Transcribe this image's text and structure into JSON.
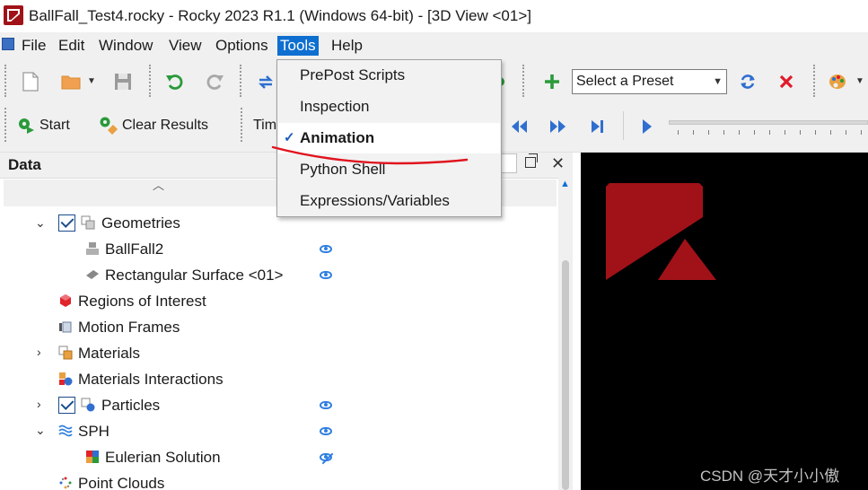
{
  "window": {
    "title": "BallFall_Test4.rocky - Rocky 2023 R1.1 (Windows 64-bit) - [3D View <01>]",
    "icon": "rocky-app-icon"
  },
  "menu": {
    "items": [
      {
        "label": "File",
        "name": "menu-file"
      },
      {
        "label": "Edit",
        "name": "menu-edit"
      },
      {
        "label": "Window",
        "name": "menu-window"
      },
      {
        "label": "View",
        "name": "menu-view"
      },
      {
        "label": "Options",
        "name": "menu-options"
      },
      {
        "label": "Tools",
        "name": "menu-tools"
      },
      {
        "label": "Help",
        "name": "menu-help"
      }
    ],
    "active": "Tools"
  },
  "tools_menu": {
    "items": [
      {
        "label": "PrePost Scripts",
        "checked": false
      },
      {
        "label": "Inspection",
        "checked": false
      },
      {
        "label": "Animation",
        "checked": true
      },
      {
        "label": "Python Shell",
        "checked": false
      },
      {
        "label": "Expressions/Variables",
        "checked": false
      }
    ]
  },
  "toolbar": {
    "start_label": "Start",
    "clear_results_label": "Clear Results",
    "time_label_partial": "Tim",
    "preset_select_value": "Select a Preset",
    "icons": [
      "new-file-icon",
      "open-folder-icon",
      "save-icon",
      "undo-icon",
      "redo-icon",
      "add-icon",
      "refresh-icon",
      "delete-icon",
      "palette-icon",
      "first-frame-icon",
      "previous-frame-icon",
      "next-frame-icon",
      "last-frame-icon",
      "play-icon"
    ]
  },
  "data_panel": {
    "title": "Data",
    "tree": [
      {
        "label": "Geometries",
        "level": 1,
        "expanded": true,
        "checkbox": true,
        "icon": "geometries-icon",
        "eye": false
      },
      {
        "label": "BallFall2",
        "level": 2,
        "icon": "wall-icon",
        "eye": "visible"
      },
      {
        "label": "Rectangular Surface <01>",
        "level": 2,
        "icon": "surface-icon",
        "eye": "visible"
      },
      {
        "label": "Regions of Interest",
        "level": 1,
        "icon": "regions-icon",
        "eye": false
      },
      {
        "label": "Motion Frames",
        "level": 1,
        "icon": "motion-frames-icon",
        "eye": false
      },
      {
        "label": "Materials",
        "level": 1,
        "expanded": false,
        "icon": "materials-icon",
        "eye": false
      },
      {
        "label": "Materials Interactions",
        "level": 1,
        "icon": "materials-interactions-icon",
        "eye": false
      },
      {
        "label": "Particles",
        "level": 1,
        "expanded": false,
        "checkbox": true,
        "icon": "particles-icon",
        "eye": "visible"
      },
      {
        "label": "SPH",
        "level": 1,
        "expanded": true,
        "icon": "sph-icon",
        "eye": "visible"
      },
      {
        "label": "Eulerian Solution",
        "level": 2,
        "icon": "eulerian-icon",
        "eye": "hidden"
      },
      {
        "label": "Point Clouds",
        "level": 1,
        "icon": "point-clouds-icon",
        "eye": false
      }
    ]
  },
  "colors": {
    "accent": "#0f6fd0",
    "brand_red": "#a01218",
    "eye_blue": "#2f7fe0",
    "annotation_red": "#e0141e"
  },
  "watermark": "CSDN @天才小小傲"
}
